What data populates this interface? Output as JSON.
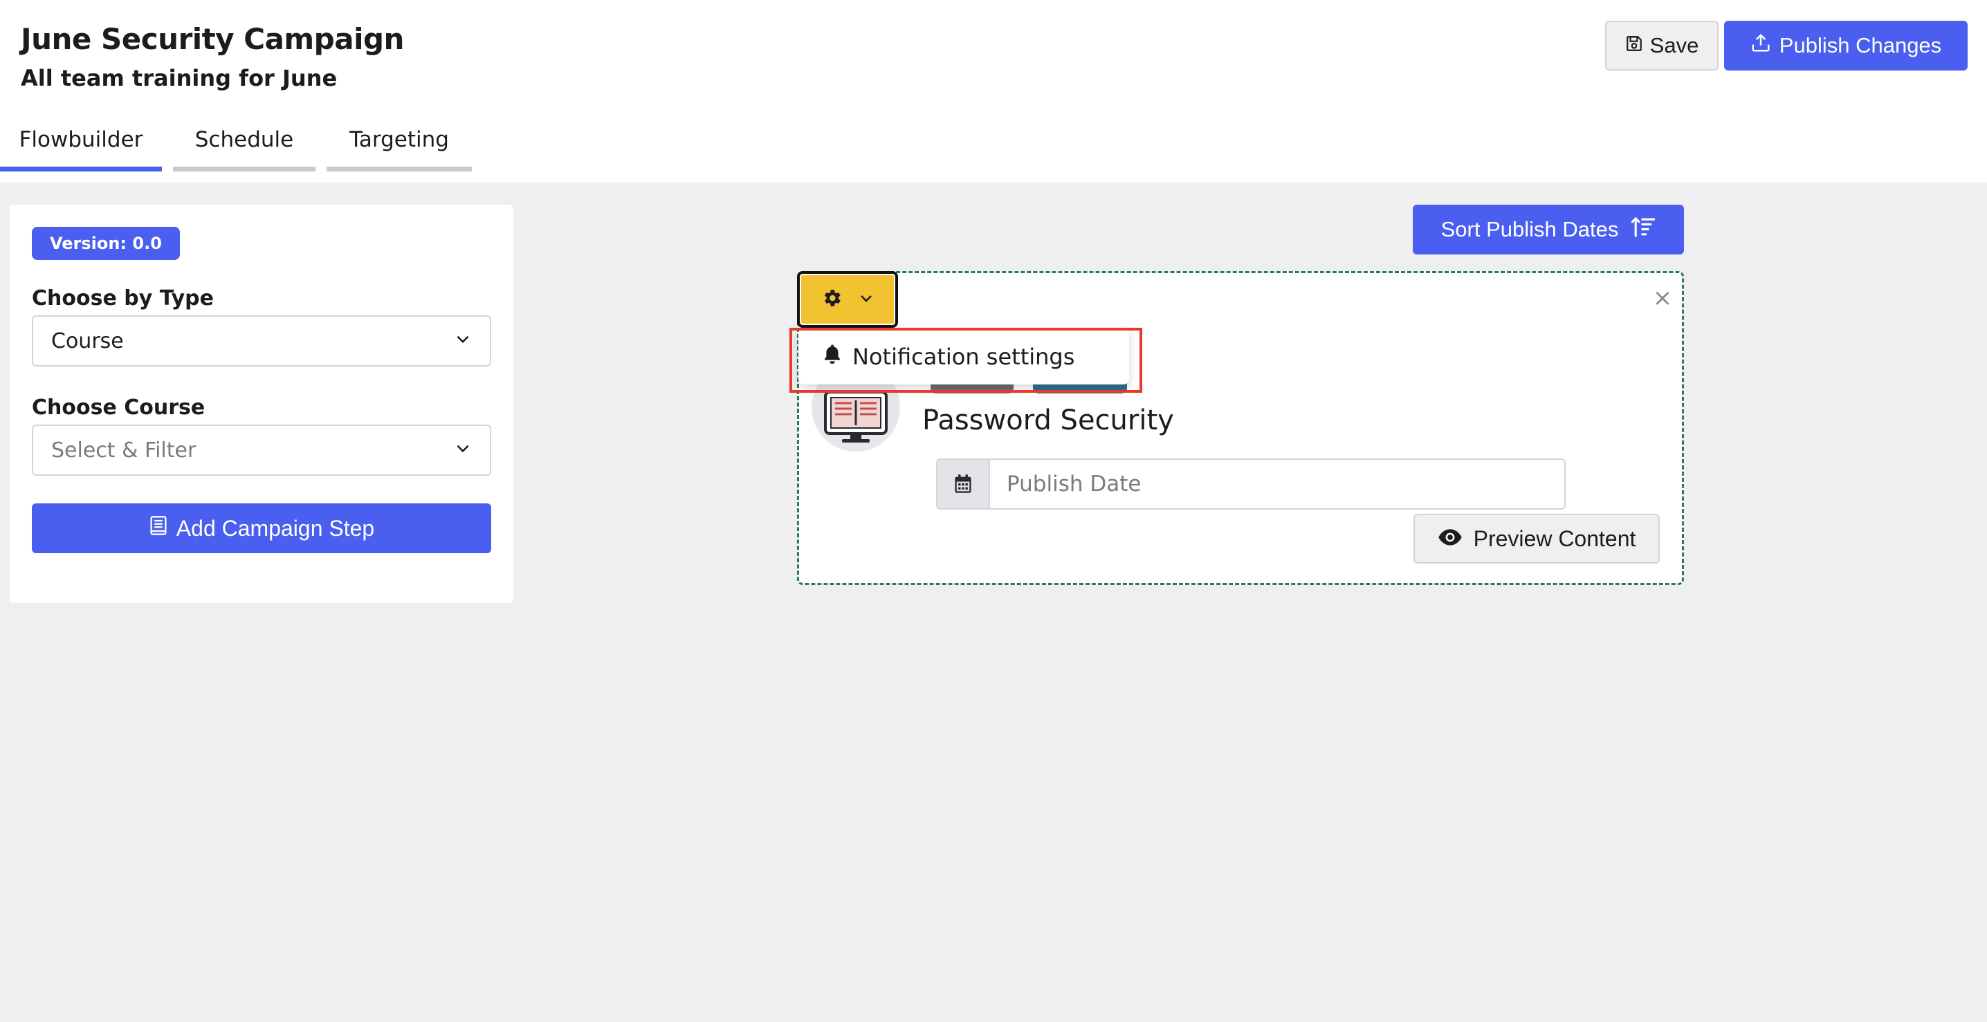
{
  "header": {
    "title": "June Security Campaign",
    "subtitle": "All team training for June",
    "save_label": "Save",
    "publish_label": "Publish Changes"
  },
  "tabs": [
    {
      "label": "Flowbuilder",
      "active": true
    },
    {
      "label": "Schedule",
      "active": false
    },
    {
      "label": "Targeting",
      "active": false
    }
  ],
  "sidebar": {
    "version": "Version: 0.0",
    "type_label": "Choose by Type",
    "type_value": "Course",
    "course_label": "Choose Course",
    "course_placeholder": "Select & Filter",
    "add_step_label": "Add Campaign Step"
  },
  "canvas": {
    "sort_label": "Sort Publish Dates",
    "card": {
      "course_title": "Password Security",
      "date_placeholder": "Publish Date",
      "preview_label": "Preview Content",
      "close_symbol": "×"
    },
    "settings_menu": {
      "items": [
        {
          "label": "Notification settings",
          "icon": "bell-icon"
        }
      ]
    }
  },
  "colors": {
    "primary": "#4a5ef0",
    "warning": "#f2c230",
    "dashed_border": "#2e7a4f",
    "highlight": "#e53a2e",
    "background": "#efeff1"
  }
}
